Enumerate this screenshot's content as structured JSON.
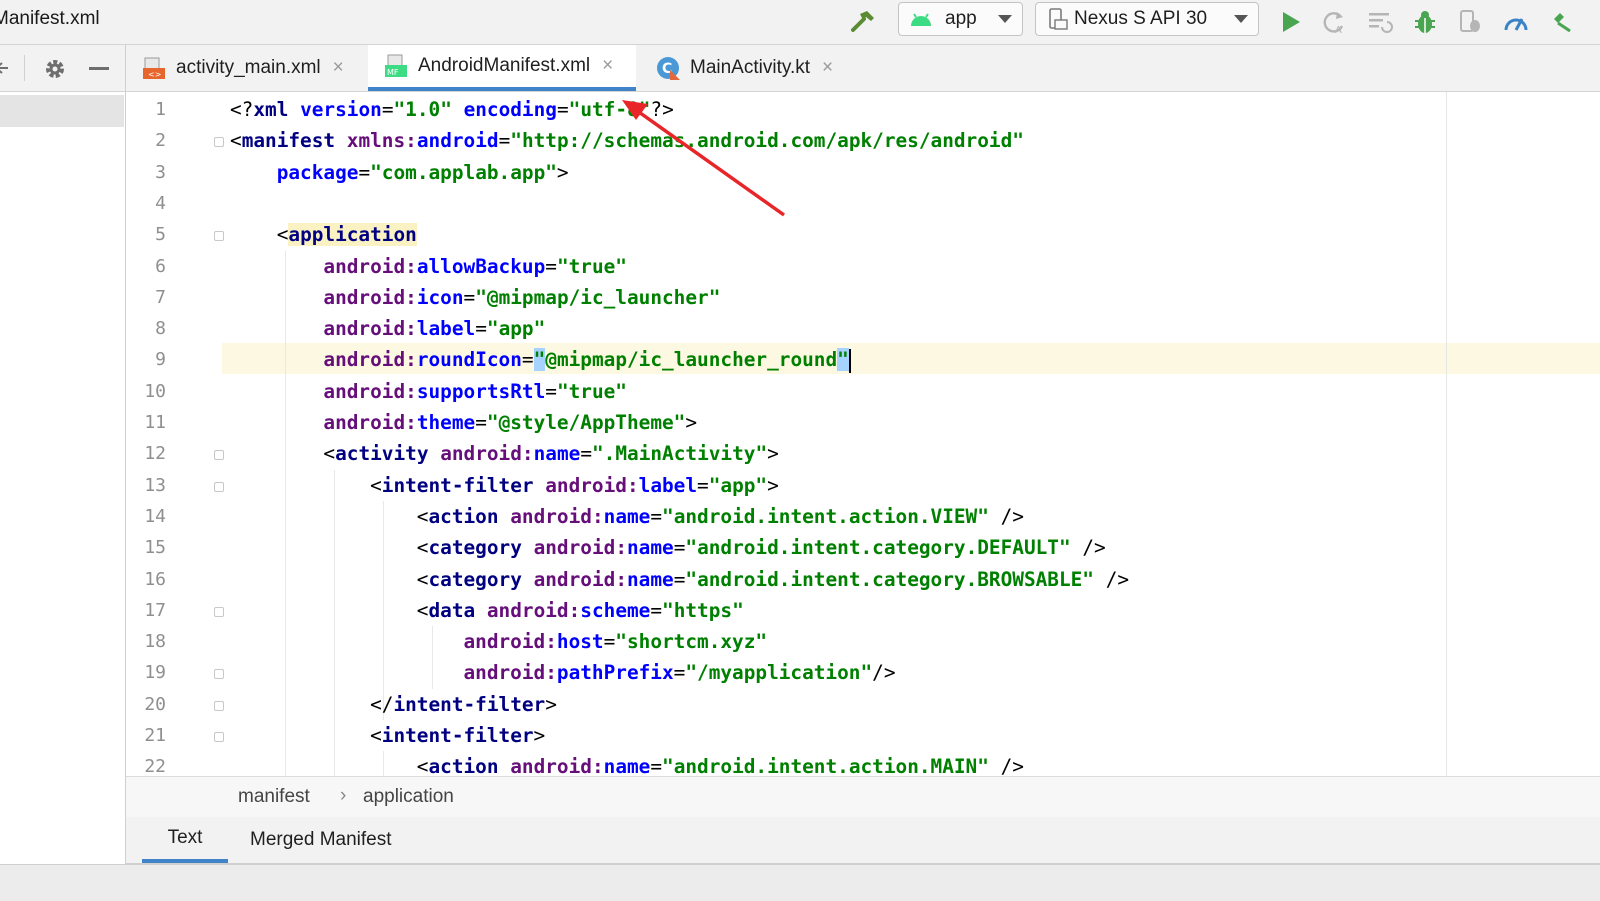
{
  "window": {
    "title": "Manifest.xml"
  },
  "toolbar": {
    "run_config": "app",
    "device": "Nexus S API 30",
    "icons": [
      "hammer-icon",
      "android-icon",
      "device-icon",
      "run-icon",
      "apply-changes-icon",
      "apply-code-changes-icon",
      "debug-icon",
      "attach-debugger-icon",
      "profiler-icon"
    ]
  },
  "tabs": [
    {
      "label": "activity_main.xml",
      "close": "×",
      "active": false
    },
    {
      "label": "AndroidManifest.xml",
      "close": "×",
      "active": true
    },
    {
      "label": "MainActivity.kt",
      "close": "×",
      "active": false
    }
  ],
  "editor": {
    "current_line": 9,
    "lines": [
      "<?xml version=\"1.0\" encoding=\"utf-8\"?>",
      "<manifest xmlns:android=\"http://schemas.android.com/apk/res/android\"",
      "    package=\"com.applab.app\">",
      "",
      "    <application",
      "        android:allowBackup=\"true\"",
      "        android:icon=\"@mipmap/ic_launcher\"",
      "        android:label=\"app\"",
      "        android:roundIcon=\"@mipmap/ic_launcher_round\"",
      "        android:supportsRtl=\"true\"",
      "        android:theme=\"@style/AppTheme\">",
      "        <activity android:name=\".MainActivity\">",
      "            <intent-filter android:label=\"app\">",
      "                <action android:name=\"android.intent.action.VIEW\" />",
      "                <category android:name=\"android.intent.category.DEFAULT\" />",
      "                <category android:name=\"android.intent.category.BROWSABLE\" />",
      "                <data android:scheme=\"https\"",
      "                    android:host=\"shortcm.xyz\"",
      "                    android:pathPrefix=\"/myapplication\"/>",
      "            </intent-filter>",
      "            <intent-filter>",
      "                <action android:name=\"android.intent.action.MAIN\" />"
    ],
    "line_numbers": [
      "1",
      "2",
      "3",
      "4",
      "5",
      "6",
      "7",
      "8",
      "9",
      "10",
      "11",
      "12",
      "13",
      "14",
      "15",
      "16",
      "17",
      "18",
      "19",
      "20",
      "21",
      "22"
    ]
  },
  "breadcrumb": {
    "items": [
      "manifest",
      "application"
    ],
    "separator": "›"
  },
  "bottom_tabs": [
    {
      "label": "Text",
      "active": true
    },
    {
      "label": "Merged Manifest",
      "active": false
    }
  ],
  "colors": {
    "accent": "#4083c9",
    "annotation_arrow": "#e8262a",
    "tag": "#000080",
    "attr_namespace": "#660e7a",
    "attr_name": "#0000ff",
    "string": "#008000"
  }
}
